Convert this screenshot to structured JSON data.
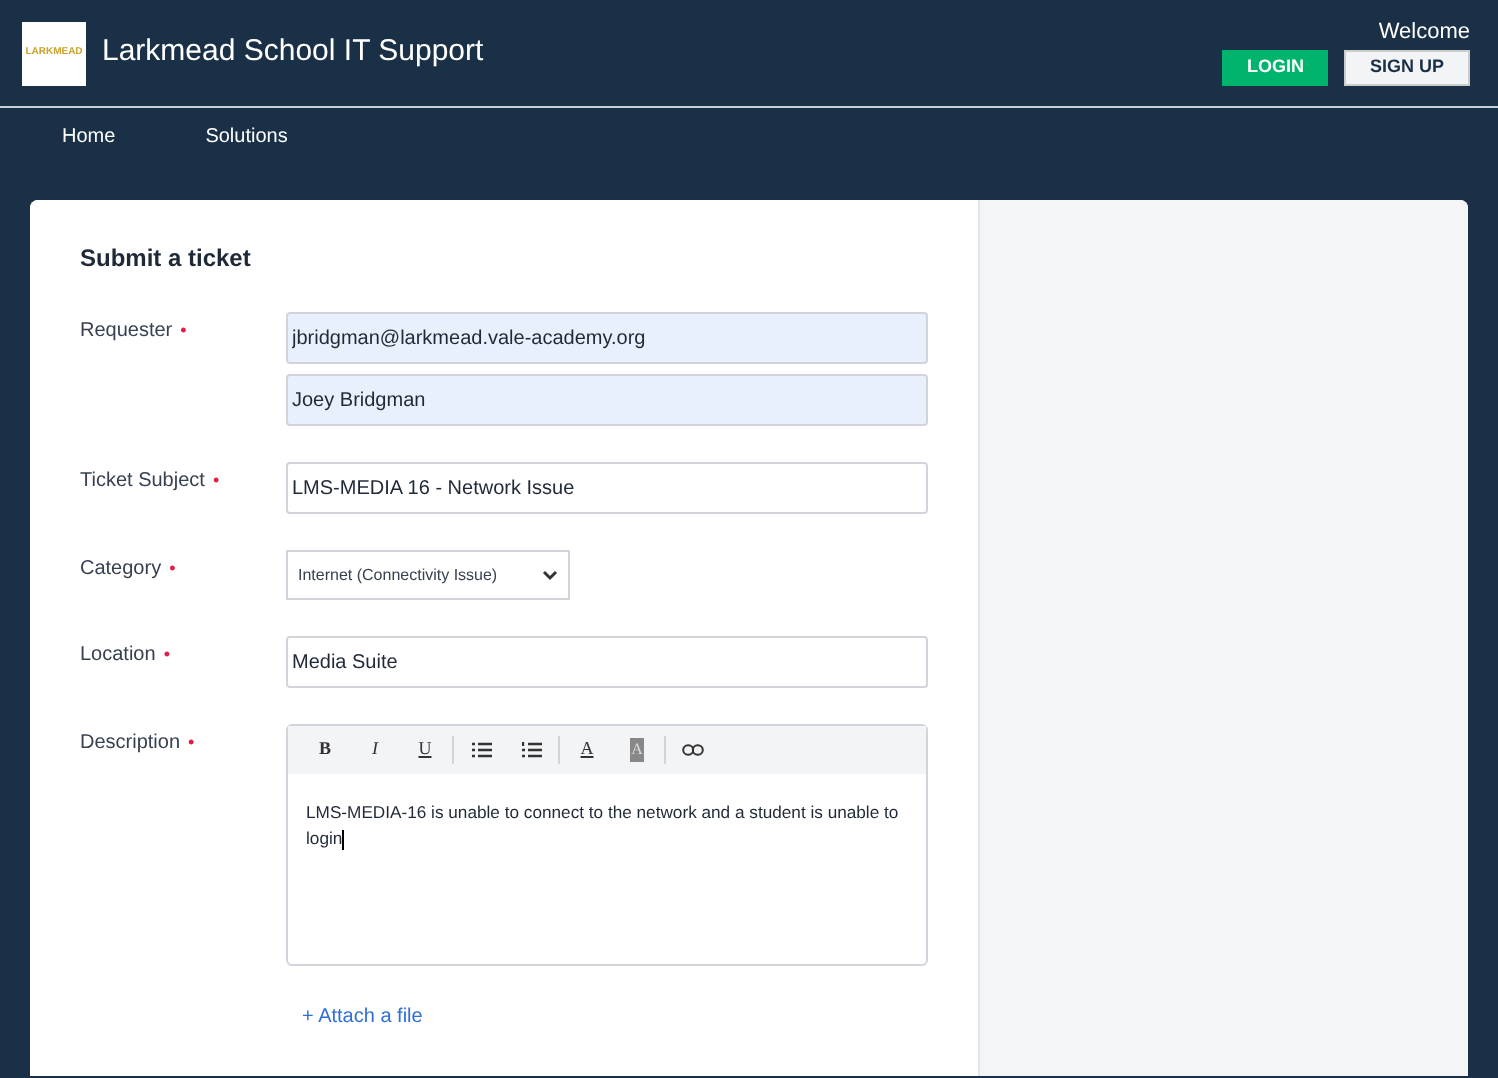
{
  "header": {
    "logo_text": "LARKMEAD",
    "title": "Larkmead School IT Support",
    "welcome": "Welcome",
    "buttons": [
      {
        "kind": "primary",
        "label": "LOGIN"
      },
      {
        "kind": "secondary",
        "label": "SIGN UP"
      }
    ]
  },
  "nav": [
    {
      "label": "Home"
    },
    {
      "label": "Solutions"
    }
  ],
  "form": {
    "title": "Submit a ticket",
    "required_mark": "•",
    "fields": [
      {
        "kind": "autofill",
        "label": "Requester",
        "required": true,
        "values": [
          "jbridgman@larkmead.vale-academy.org",
          "Joey Bridgman"
        ]
      },
      {
        "kind": "text",
        "label": "Ticket Subject",
        "required": true,
        "value": "LMS-MEDIA 16 - Network Issue"
      },
      {
        "kind": "select",
        "label": "Category",
        "required": true,
        "value": "Internet (Connectivity Issue)"
      },
      {
        "kind": "text",
        "label": "Location",
        "required": true,
        "value": "Media Suite"
      },
      {
        "kind": "editor",
        "label": "Description",
        "required": true,
        "value": "LMS-MEDIA-16 is unable to connect to the network and a student is unable to login",
        "toolbar_groups": [
          [
            {
              "kind": "bold",
              "label": "B"
            },
            {
              "kind": "italic",
              "label": "I"
            },
            {
              "kind": "underline",
              "label": "U"
            }
          ],
          [
            {
              "kind": "bullet-list"
            },
            {
              "kind": "numbered-list"
            }
          ],
          [
            {
              "kind": "text-color",
              "label": "A"
            },
            {
              "kind": "highlight",
              "label": "A"
            }
          ],
          [
            {
              "kind": "link"
            }
          ]
        ]
      }
    ],
    "attach_link": "+ Attach a file"
  }
}
